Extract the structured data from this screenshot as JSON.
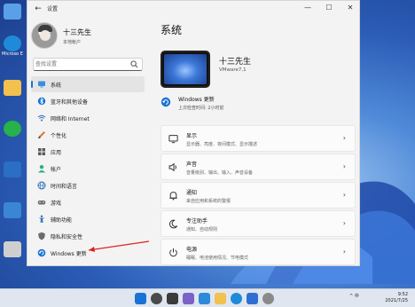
{
  "desktop": {
    "icons": [
      {
        "caption": "",
        "color": "#5aa0e8"
      },
      {
        "caption": "Microso Edge",
        "color": "#1f8ad8"
      },
      {
        "caption": "",
        "color": "#f2c14e"
      },
      {
        "caption": "",
        "color": "#27b24a"
      },
      {
        "caption": "",
        "color": "#2a6fc4"
      },
      {
        "caption": "",
        "color": "#3a86d4"
      },
      {
        "caption": "",
        "color": "#cfcfcf"
      }
    ]
  },
  "window": {
    "app_title": "设置",
    "back_glyph": "←",
    "minimize_glyph": "—",
    "maximize_glyph": "☐",
    "close_glyph": "✕"
  },
  "profile": {
    "name": "十三先生",
    "account": "本地帐户"
  },
  "search": {
    "placeholder": "查找设置"
  },
  "nav": {
    "items": [
      {
        "label": "系统",
        "icon": "monitor-icon",
        "active": true
      },
      {
        "label": "蓝牙和其他设备",
        "icon": "bluetooth-icon"
      },
      {
        "label": "网络和 Internet",
        "icon": "wifi-icon"
      },
      {
        "label": "个性化",
        "icon": "brush-icon"
      },
      {
        "label": "应用",
        "icon": "apps-icon"
      },
      {
        "label": "帐户",
        "icon": "person-icon"
      },
      {
        "label": "时间和语言",
        "icon": "globe-icon"
      },
      {
        "label": "游戏",
        "icon": "gamepad-icon"
      },
      {
        "label": "辅助功能",
        "icon": "accessibility-icon"
      },
      {
        "label": "隐私和安全性",
        "icon": "shield-icon"
      },
      {
        "label": "Windows 更新",
        "icon": "update-icon"
      }
    ]
  },
  "main": {
    "page_title": "系统",
    "device_name": "十三先生",
    "device_model": "VMware7,1",
    "update_title": "Windows 更新",
    "update_subtitle": "上次检查时间: 2小时前",
    "cards": [
      {
        "title": "显示",
        "subtitle": "显示器、亮度、夜间模式、显示描述",
        "icon": "display-icon"
      },
      {
        "title": "声音",
        "subtitle": "音量级别、输出、输入、声音设备",
        "icon": "speaker-icon"
      },
      {
        "title": "通知",
        "subtitle": "来自应用和系统的警报",
        "icon": "bell-icon"
      },
      {
        "title": "专注助手",
        "subtitle": "通知、自动规则",
        "icon": "moon-icon"
      },
      {
        "title": "电源",
        "subtitle": "睡眠、电池使用情况、节电模式",
        "icon": "power-icon"
      }
    ],
    "chevron": "›"
  },
  "taskbar": {
    "tray_text": "^ 中",
    "time": "9:52",
    "date": "2021/7/25",
    "accent": "#1a73d4"
  }
}
